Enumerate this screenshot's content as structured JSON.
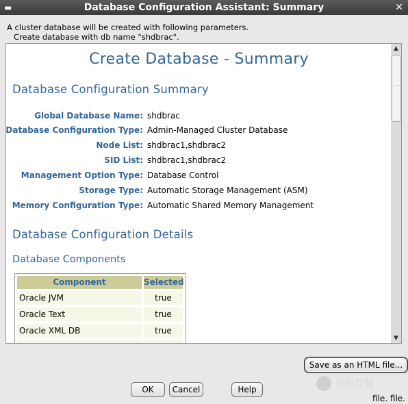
{
  "window": {
    "title": "Database Configuration Assistant: Summary",
    "menu_icon": "window-menu-icon",
    "close_icon": "close-icon"
  },
  "intro": {
    "line1": "A cluster database will be created with following parameters.",
    "line2": "Create database with db name \"shdbrac\"."
  },
  "summary": {
    "title": "Create Database - Summary",
    "section1": "Database Configuration Summary",
    "params": [
      {
        "label": "Global Database Name:",
        "value": "shdbrac"
      },
      {
        "label": "Database Configuration Type:",
        "value": "Admin-Managed Cluster Database"
      },
      {
        "label": "Node List:",
        "value": "shdbrac1,shdbrac2"
      },
      {
        "label": "SID List:",
        "value": "shdbrac1,shdbrac2"
      },
      {
        "label": "Management Option Type:",
        "value": "Database Control"
      },
      {
        "label": "Storage Type:",
        "value": "Automatic Storage Management (ASM)"
      },
      {
        "label": "Memory Configuration Type:",
        "value": "Automatic Shared Memory Management"
      }
    ],
    "section2": "Database Configuration Details",
    "section3": "Database Components",
    "components": {
      "headers": [
        "Component",
        "Selected"
      ],
      "rows": [
        [
          "Oracle JVM",
          "true"
        ],
        [
          "Oracle Text",
          "true"
        ],
        [
          "Oracle XML DB",
          "true"
        ]
      ]
    }
  },
  "buttons": {
    "save_html": "Save as an HTML file...",
    "ok": "OK",
    "cancel": "Cancel",
    "help": "Help"
  },
  "watermark": "创新互联",
  "footer": "file. file."
}
